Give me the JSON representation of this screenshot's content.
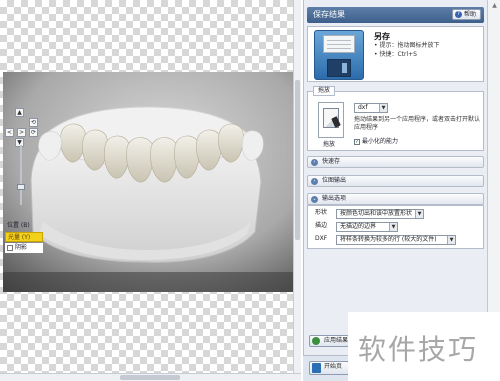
{
  "viewport": {
    "nav_buttons": [
      "▲",
      "▼",
      "<",
      ">",
      "⟲",
      "⟳"
    ],
    "view_panel": {
      "position_label": "位置 (B)",
      "light_label": "光量 (Y)",
      "shadow_label": "阴影"
    }
  },
  "panel": {
    "title": "保存结果",
    "help_label": "帮助",
    "save_as": {
      "title": "另存",
      "hint1": "• 提示：拖动图标并放下",
      "hint2": "• 快捷：Ctrl+S"
    },
    "drag_section": {
      "tab_label": "拖放",
      "format_value": "dxf",
      "description": "拖动结果到另一个应用程序，或者双击打开默认应用程序",
      "icon_caption": "拖放",
      "minimize_label": "最小化的能力",
      "minimize_checked": "✓"
    },
    "sections": {
      "quick_save": "快速存",
      "position_output": "位图输出",
      "output_options": "输出选项"
    },
    "output_options": {
      "shape_label": "形状",
      "shape_value": "按颜色切出和该中放置形状",
      "fill_label": "描边",
      "fill_value": "无描边的边界",
      "dxf_label": "DXF",
      "dxf_value": "将样条转换为较多的行 (较大的文件)"
    },
    "bottom": {
      "apply_button": "应用结果",
      "start_button": "开始页"
    }
  },
  "watermark": "软件技巧",
  "colors": {
    "title_bar": "#4a6c98",
    "light_highlight": "#f3d11a",
    "panel_bg": "#eaeef4"
  }
}
